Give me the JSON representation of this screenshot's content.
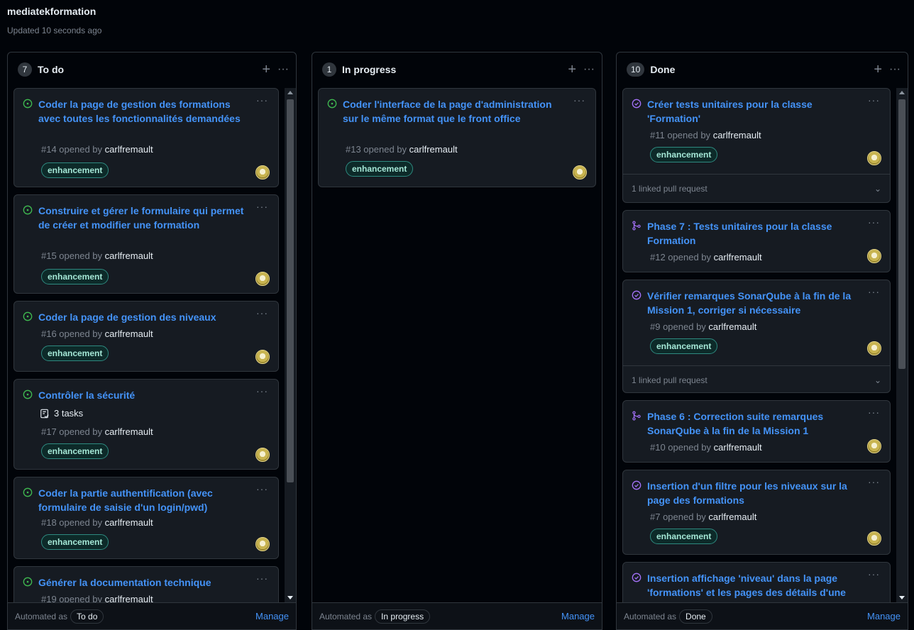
{
  "project": {
    "title": "mediatekformation",
    "updated": "Updated 10 seconds ago"
  },
  "colors": {
    "open_icon": "#3fb950",
    "closed_icon": "#a371f7",
    "link": "#4493f8"
  },
  "columns": [
    {
      "count": "7",
      "name": "To do",
      "automated_label": "Automated as",
      "automated_value": "To do",
      "manage": "Manage",
      "cards": [
        {
          "title": "Coder la page de gestion des formations avec toutes les fonctionnalités demandées",
          "num": "#14 opened by",
          "author": "carlfremault",
          "label": "enhancement",
          "state": "open"
        },
        {
          "title": "Construire et gérer le formulaire qui permet de créer et modifier une formation",
          "num": "#15 opened by",
          "author": "carlfremault",
          "label": "enhancement",
          "state": "open"
        },
        {
          "title": "Coder la page de gestion des niveaux",
          "num": "#16 opened by",
          "author": "carlfremault",
          "label": "enhancement",
          "state": "open"
        },
        {
          "title": "Contrôler la sécurité",
          "tasks": "3 tasks",
          "num": "#17 opened by",
          "author": "carlfremault",
          "label": "enhancement",
          "state": "open"
        },
        {
          "title": "Coder la partie authentification (avec formulaire de saisie d'un login/pwd)",
          "num": "#18 opened by",
          "author": "carlfremault",
          "label": "enhancement",
          "state": "open"
        },
        {
          "title": "Générer la documentation technique",
          "num": "#19 opened by",
          "author": "carlfremault",
          "state": "open"
        }
      ]
    },
    {
      "count": "1",
      "name": "In progress",
      "automated_label": "Automated as",
      "automated_value": "In progress",
      "manage": "Manage",
      "cards": [
        {
          "title": "Coder l'interface de la page d'administration sur le même format que le front office",
          "num": "#13 opened by",
          "author": "carlfremault",
          "label": "enhancement",
          "state": "open"
        }
      ]
    },
    {
      "count": "10",
      "name": "Done",
      "automated_label": "Automated as",
      "automated_value": "Done",
      "manage": "Manage",
      "cards": [
        {
          "title": "Créer tests unitaires pour la classe 'Formation'",
          "num": "#11 opened by",
          "author": "carlfremault",
          "label": "enhancement",
          "state": "closed",
          "linked": "1 linked pull request"
        },
        {
          "title": "Phase 7 : Tests unitaires pour la classe Formation",
          "num": "#12 opened by",
          "author": "carlfremault",
          "state": "merged"
        },
        {
          "title": "Vérifier remarques SonarQube à la fin de la Mission 1, corriger si nécessaire",
          "num": "#9 opened by",
          "author": "carlfremault",
          "label": "enhancement",
          "state": "closed",
          "linked": "1 linked pull request"
        },
        {
          "title": "Phase 6 : Correction suite remarques SonarQube à la fin de la Mission 1",
          "num": "#10 opened by",
          "author": "carlfremault",
          "state": "merged"
        },
        {
          "title": "Insertion d'un filtre pour les niveaux sur la page des formations",
          "num": "#7 opened by",
          "author": "carlfremault",
          "label": "enhancement",
          "state": "closed"
        },
        {
          "title": "Insertion affichage 'niveau' dans la page 'formations' et les pages des détails d'une formation",
          "state": "closed"
        }
      ]
    }
  ]
}
